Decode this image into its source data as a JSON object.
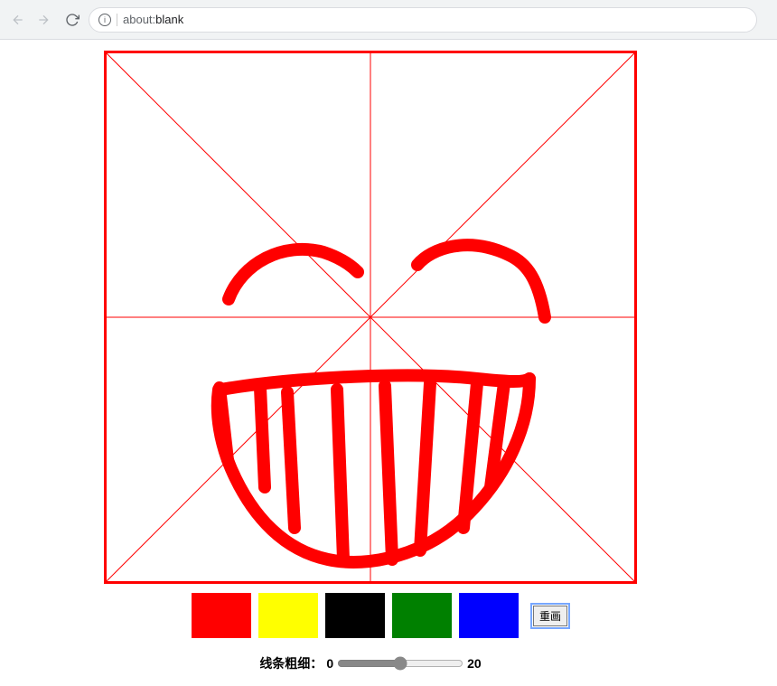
{
  "browser": {
    "url_scheme": "about:",
    "url_page": "blank"
  },
  "canvas": {
    "size": 584,
    "border_color": "red",
    "guide_color": "red",
    "stroke_color": "red",
    "stroke_width": 14,
    "strokes": [
      "M135,272 C150,232 195,208 240,220 C255,225 268,232 278,242",
      "M344,234 C360,215 400,202 445,223 C465,232 478,250 485,292",
      "M126,372 C210,358 340,352 410,360 C440,363 460,365 468,360",
      "M468,360 C468,410 445,465 400,510 C355,555 290,570 245,560 C198,550 162,515 138,460 C126,432 120,400 124,372",
      "M170,370 L175,480",
      "M200,375 L208,525",
      "M255,372 L262,560",
      "M308,368 L316,560",
      "M358,365 L347,550",
      "M410,365 L395,525",
      "M440,365 L425,480",
      "M125,370 L134,450"
    ]
  },
  "palette": {
    "colors": [
      {
        "name": "red",
        "hex": "#ff0000"
      },
      {
        "name": "yellow",
        "hex": "#ffff00"
      },
      {
        "name": "black",
        "hex": "#000000"
      },
      {
        "name": "green",
        "hex": "#008000"
      },
      {
        "name": "blue",
        "hex": "#0000ff"
      }
    ],
    "reset_label": "重画"
  },
  "slider": {
    "label": "线条粗细：",
    "min": 0,
    "max": 20,
    "value": 10
  }
}
